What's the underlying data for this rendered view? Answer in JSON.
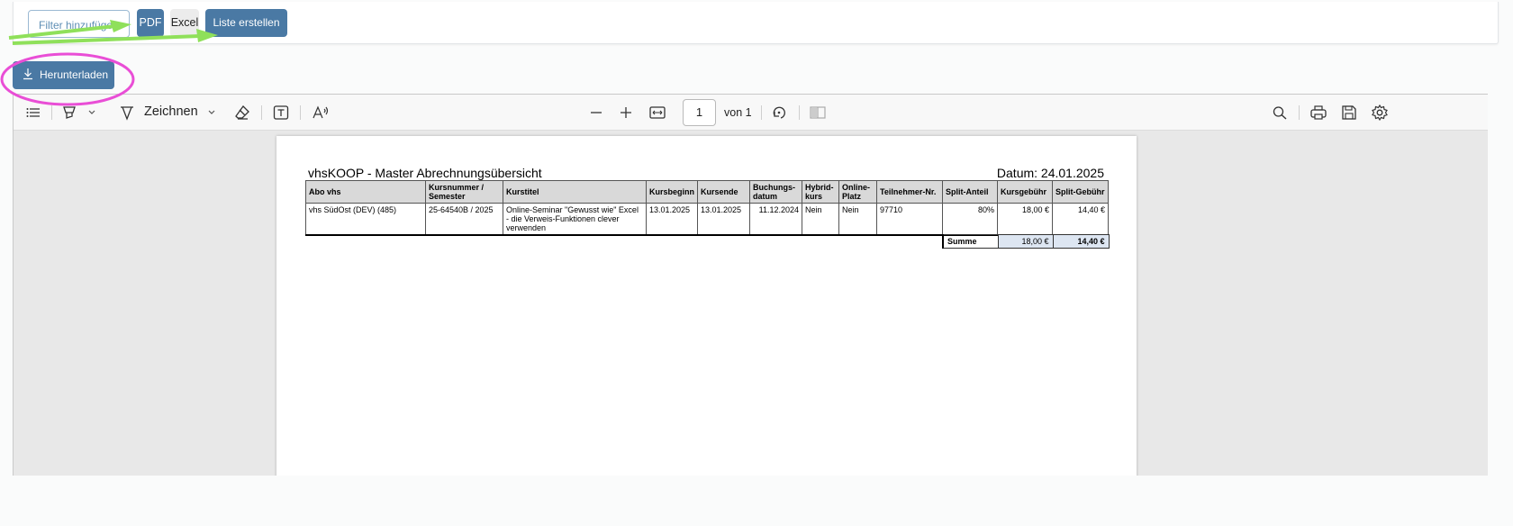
{
  "toolbar": {
    "filter_label": "Filter hinzufügen",
    "pdf_label": "PDF",
    "excel_label": "Excel",
    "liste_label": "Liste erstellen"
  },
  "download_label": "Herunterladen",
  "viewer": {
    "draw_label": "Zeichnen",
    "page_number": "1",
    "page_of": "von 1"
  },
  "document": {
    "title": "vhsKOOP - Master Abrechnungsübersicht",
    "date": "Datum: 24.01.2025",
    "columns": [
      "Abo vhs",
      "Kursnummer / Semester",
      "Kurstitel",
      "Kursbeginn",
      "Kursende",
      "Buchungs-datum",
      "Hybrid-kurs",
      "Online-Platz",
      "Teilnehmer-Nr.",
      "Split-Anteil",
      "Kursgebühr",
      "Split-Gebühr"
    ],
    "rows": [
      {
        "abo_vhs": "vhs SüdOst (DEV) (485)",
        "kursnummer": "25-64540B / 2025",
        "kurstitel": "Online-Seminar \"Gewusst wie\" Excel - die Verweis-Funktionen clever verwenden",
        "kursbeginn": "13.01.2025",
        "kursende": "13.01.2025",
        "buchungsdatum": "11.12.2024",
        "hybridkurs": "Nein",
        "online_platz": "Nein",
        "teilnehmer_nr": "97710",
        "split_anteil": "80%",
        "kursgebuehr": "18,00 €",
        "split_gebuehr": "14,40 €"
      }
    ],
    "sum": {
      "label": "Summe",
      "kursgebuehr": "18,00 €",
      "split_gebuehr": "14,40 €"
    }
  },
  "colors": {
    "primary": "#4a79a4",
    "annotation_arrow": "#8fe05a",
    "annotation_circle": "#e94ed6"
  }
}
